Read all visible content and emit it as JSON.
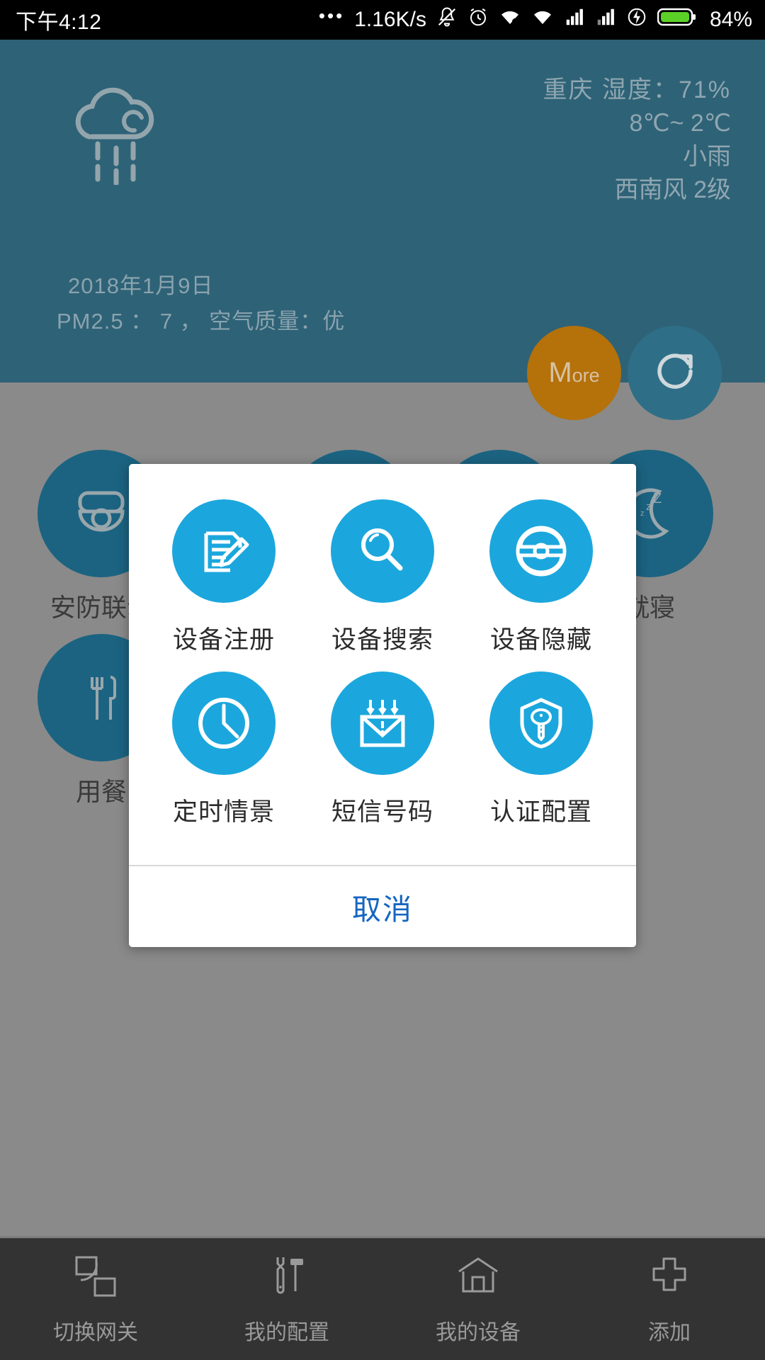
{
  "status_bar": {
    "time": "下午4:12",
    "dots": "•••",
    "network_speed": "1.16K/s",
    "battery_percent": "84%",
    "icons": [
      "mute-bell-icon",
      "alarm-clock-icon",
      "wifi-icon",
      "wifi-icon",
      "signal-bars-icon",
      "signal-bars-icon",
      "charging-bolt-icon",
      "battery-icon"
    ]
  },
  "weather": {
    "icon": "cloud-rain-icon",
    "city": "重庆",
    "humidity_line": "重庆  湿度：71%",
    "temperature_line": "8℃~  2℃",
    "condition": "小雨",
    "wind": "西南风  2级",
    "date": "2018年1月9日",
    "air_quality": "PM2.5 ：  7 ，  空气质量：优"
  },
  "buttons": {
    "more_big": "M",
    "more_rest": "ore",
    "refresh_icon": "refresh-icon"
  },
  "scenes": [
    {
      "label": "安防联动",
      "icon": "security-camera-icon"
    },
    {
      "label": "就寝",
      "icon": "moon-sleep-icon"
    },
    {
      "label": "用餐",
      "icon": "fork-knife-icon"
    }
  ],
  "dialog": {
    "items": [
      {
        "label": "设备注册",
        "icon": "document-pencil-icon"
      },
      {
        "label": "设备搜索",
        "icon": "magnifier-icon"
      },
      {
        "label": "设备隐藏",
        "icon": "hidden-eye-icon"
      },
      {
        "label": "定时情景",
        "icon": "clock-icon"
      },
      {
        "label": "短信号码",
        "icon": "envelope-download-icon"
      },
      {
        "label": "认证配置",
        "icon": "shield-key-icon"
      }
    ],
    "cancel_label": "取消"
  },
  "bottom_nav": [
    {
      "label": "切换网关",
      "icon": "switch-gateway-icon"
    },
    {
      "label": "我的配置",
      "icon": "wrench-hammer-icon"
    },
    {
      "label": "我的设备",
      "icon": "home-icon"
    },
    {
      "label": "添加",
      "icon": "plus-icon"
    }
  ],
  "colors": {
    "header_bg": "#2e6277",
    "page_bg": "#8a8a8a",
    "accent_blue": "#1ba7dd",
    "scene_blue": "#1b6381",
    "more_orange": "#b5710a",
    "cancel_blue": "#1565c0",
    "nav_bg": "#333333"
  }
}
